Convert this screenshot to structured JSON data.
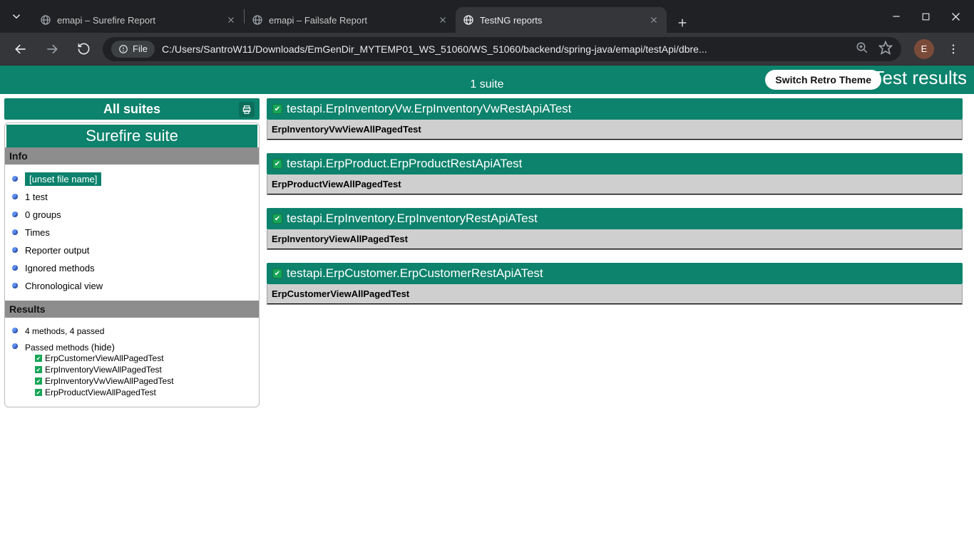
{
  "browser": {
    "tabs": [
      {
        "title": "emapi – Surefire Report"
      },
      {
        "title": "emapi – Failsafe Report"
      },
      {
        "title": "TestNG reports"
      }
    ],
    "active_tab": 2,
    "address_chip": "File",
    "url": "C:/Users/SantroW11/Downloads/EmGenDir_MYTEMP01_WS_51060/WS_51060/backend/spring-java/emapi/testApi/dbre...",
    "profile_initial": "E"
  },
  "page": {
    "retro_button": "Switch Retro Theme",
    "results_title": "Test results",
    "suite_count": "1 suite",
    "all_suites": "All suites",
    "suite_name": "Surefire suite",
    "info_header": "Info",
    "info_items": [
      "[unset file name]",
      "1 test",
      "0 groups",
      "Times",
      "Reporter output",
      "Ignored methods",
      "Chronological view"
    ],
    "results_header": "Results",
    "results_summary": "4 methods, 4 passed",
    "passed_label": "Passed methods",
    "hide_label": "(hide)",
    "passed_methods": [
      "ErpCustomerViewAllPagedTest",
      "ErpInventoryViewAllPagedTest",
      "ErpInventoryVwViewAllPagedTest",
      "ErpProductViewAllPagedTest"
    ],
    "tests": [
      {
        "class": "testapi.ErpInventoryVw.ErpInventoryVwRestApiATest",
        "method": "ErpInventoryVwViewAllPagedTest"
      },
      {
        "class": "testapi.ErpProduct.ErpProductRestApiATest",
        "method": "ErpProductViewAllPagedTest"
      },
      {
        "class": "testapi.ErpInventory.ErpInventoryRestApiATest",
        "method": "ErpInventoryViewAllPagedTest"
      },
      {
        "class": "testapi.ErpCustomer.ErpCustomerRestApiATest",
        "method": "ErpCustomerViewAllPagedTest"
      }
    ]
  }
}
